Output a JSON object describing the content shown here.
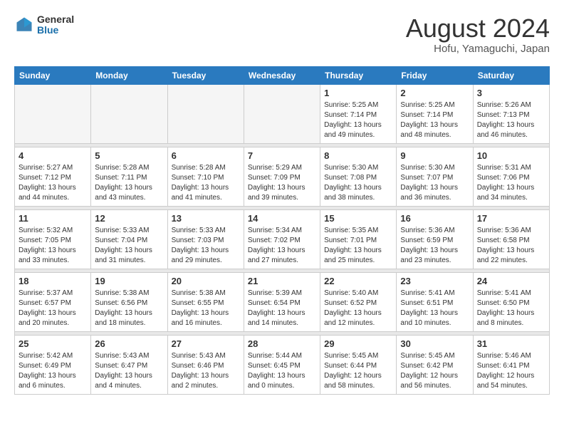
{
  "header": {
    "logo_general": "General",
    "logo_blue": "Blue",
    "month_year": "August 2024",
    "location": "Hofu, Yamaguchi, Japan"
  },
  "weekdays": [
    "Sunday",
    "Monday",
    "Tuesday",
    "Wednesday",
    "Thursday",
    "Friday",
    "Saturday"
  ],
  "weeks": [
    [
      {
        "day": "",
        "empty": true
      },
      {
        "day": "",
        "empty": true
      },
      {
        "day": "",
        "empty": true
      },
      {
        "day": "",
        "empty": true
      },
      {
        "day": "1",
        "sunrise": "5:25 AM",
        "sunset": "7:14 PM",
        "daylight": "13 hours and 49 minutes."
      },
      {
        "day": "2",
        "sunrise": "5:25 AM",
        "sunset": "7:14 PM",
        "daylight": "13 hours and 48 minutes."
      },
      {
        "day": "3",
        "sunrise": "5:26 AM",
        "sunset": "7:13 PM",
        "daylight": "13 hours and 46 minutes."
      }
    ],
    [
      {
        "day": "4",
        "sunrise": "5:27 AM",
        "sunset": "7:12 PM",
        "daylight": "13 hours and 44 minutes."
      },
      {
        "day": "5",
        "sunrise": "5:28 AM",
        "sunset": "7:11 PM",
        "daylight": "13 hours and 43 minutes."
      },
      {
        "day": "6",
        "sunrise": "5:28 AM",
        "sunset": "7:10 PM",
        "daylight": "13 hours and 41 minutes."
      },
      {
        "day": "7",
        "sunrise": "5:29 AM",
        "sunset": "7:09 PM",
        "daylight": "13 hours and 39 minutes."
      },
      {
        "day": "8",
        "sunrise": "5:30 AM",
        "sunset": "7:08 PM",
        "daylight": "13 hours and 38 minutes."
      },
      {
        "day": "9",
        "sunrise": "5:30 AM",
        "sunset": "7:07 PM",
        "daylight": "13 hours and 36 minutes."
      },
      {
        "day": "10",
        "sunrise": "5:31 AM",
        "sunset": "7:06 PM",
        "daylight": "13 hours and 34 minutes."
      }
    ],
    [
      {
        "day": "11",
        "sunrise": "5:32 AM",
        "sunset": "7:05 PM",
        "daylight": "13 hours and 33 minutes."
      },
      {
        "day": "12",
        "sunrise": "5:33 AM",
        "sunset": "7:04 PM",
        "daylight": "13 hours and 31 minutes."
      },
      {
        "day": "13",
        "sunrise": "5:33 AM",
        "sunset": "7:03 PM",
        "daylight": "13 hours and 29 minutes."
      },
      {
        "day": "14",
        "sunrise": "5:34 AM",
        "sunset": "7:02 PM",
        "daylight": "13 hours and 27 minutes."
      },
      {
        "day": "15",
        "sunrise": "5:35 AM",
        "sunset": "7:01 PM",
        "daylight": "13 hours and 25 minutes."
      },
      {
        "day": "16",
        "sunrise": "5:36 AM",
        "sunset": "6:59 PM",
        "daylight": "13 hours and 23 minutes."
      },
      {
        "day": "17",
        "sunrise": "5:36 AM",
        "sunset": "6:58 PM",
        "daylight": "13 hours and 22 minutes."
      }
    ],
    [
      {
        "day": "18",
        "sunrise": "5:37 AM",
        "sunset": "6:57 PM",
        "daylight": "13 hours and 20 minutes."
      },
      {
        "day": "19",
        "sunrise": "5:38 AM",
        "sunset": "6:56 PM",
        "daylight": "13 hours and 18 minutes."
      },
      {
        "day": "20",
        "sunrise": "5:38 AM",
        "sunset": "6:55 PM",
        "daylight": "13 hours and 16 minutes."
      },
      {
        "day": "21",
        "sunrise": "5:39 AM",
        "sunset": "6:54 PM",
        "daylight": "13 hours and 14 minutes."
      },
      {
        "day": "22",
        "sunrise": "5:40 AM",
        "sunset": "6:52 PM",
        "daylight": "13 hours and 12 minutes."
      },
      {
        "day": "23",
        "sunrise": "5:41 AM",
        "sunset": "6:51 PM",
        "daylight": "13 hours and 10 minutes."
      },
      {
        "day": "24",
        "sunrise": "5:41 AM",
        "sunset": "6:50 PM",
        "daylight": "13 hours and 8 minutes."
      }
    ],
    [
      {
        "day": "25",
        "sunrise": "5:42 AM",
        "sunset": "6:49 PM",
        "daylight": "13 hours and 6 minutes."
      },
      {
        "day": "26",
        "sunrise": "5:43 AM",
        "sunset": "6:47 PM",
        "daylight": "13 hours and 4 minutes."
      },
      {
        "day": "27",
        "sunrise": "5:43 AM",
        "sunset": "6:46 PM",
        "daylight": "13 hours and 2 minutes."
      },
      {
        "day": "28",
        "sunrise": "5:44 AM",
        "sunset": "6:45 PM",
        "daylight": "13 hours and 0 minutes."
      },
      {
        "day": "29",
        "sunrise": "5:45 AM",
        "sunset": "6:44 PM",
        "daylight": "12 hours and 58 minutes."
      },
      {
        "day": "30",
        "sunrise": "5:45 AM",
        "sunset": "6:42 PM",
        "daylight": "12 hours and 56 minutes."
      },
      {
        "day": "31",
        "sunrise": "5:46 AM",
        "sunset": "6:41 PM",
        "daylight": "12 hours and 54 minutes."
      }
    ]
  ]
}
